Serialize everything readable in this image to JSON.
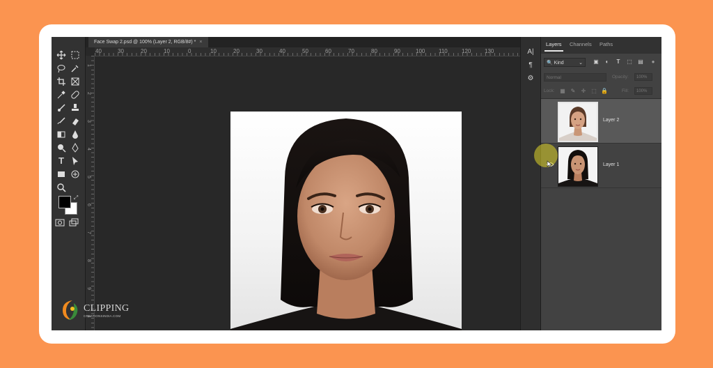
{
  "document": {
    "tab_title": "Face Swap 2.psd @ 100% (Layer 2, RGB/8#) *",
    "tab_close": "×"
  },
  "rulers": {
    "horizontal": [
      "40",
      "30",
      "20",
      "10",
      "0",
      "10",
      "20",
      "30",
      "40",
      "50",
      "60",
      "70",
      "80",
      "90",
      "100",
      "110",
      "120",
      "130"
    ],
    "vertical": [
      "1",
      "2",
      "3",
      "4",
      "5",
      "6",
      "7",
      "8",
      "9",
      "1"
    ]
  },
  "toolbar": {
    "tools": [
      "move-icon",
      "marquee-icon",
      "lasso-icon",
      "quick-select-icon",
      "crop-icon",
      "frame-icon",
      "eyedropper-icon",
      "healing-icon",
      "brush-icon",
      "stamp-icon",
      "history-brush-icon",
      "eraser-icon",
      "gradient-icon",
      "blur-icon",
      "dodge-icon",
      "pen-icon",
      "type-icon",
      "path-select-icon",
      "rectangle-icon",
      "hand-rotate-icon",
      "zoom-icon"
    ],
    "foreground_color": "#000000",
    "background_color": "#ffffff"
  },
  "panel": {
    "tabs": [
      "Layers",
      "Channels",
      "Paths"
    ],
    "active_tab": "Layers",
    "filter_kind": "Kind",
    "blend_mode": "Normal",
    "opacity_label": "Opacity:",
    "opacity_value": "100%",
    "lock_label": "Lock:",
    "fill_label": "Fill:",
    "fill_value": "100%",
    "layers": [
      {
        "name": "Layer 2",
        "selected": true,
        "visible": false
      },
      {
        "name": "Layer 1",
        "selected": false,
        "visible": true
      }
    ]
  },
  "watermark": {
    "name": "CLIPPING",
    "sub": "CREATIONSINDIA.COM"
  },
  "colors": {
    "page_background": "#fb9450",
    "app_background": "#282828",
    "panel_background": "#424242",
    "selected_layer": "#595959"
  }
}
